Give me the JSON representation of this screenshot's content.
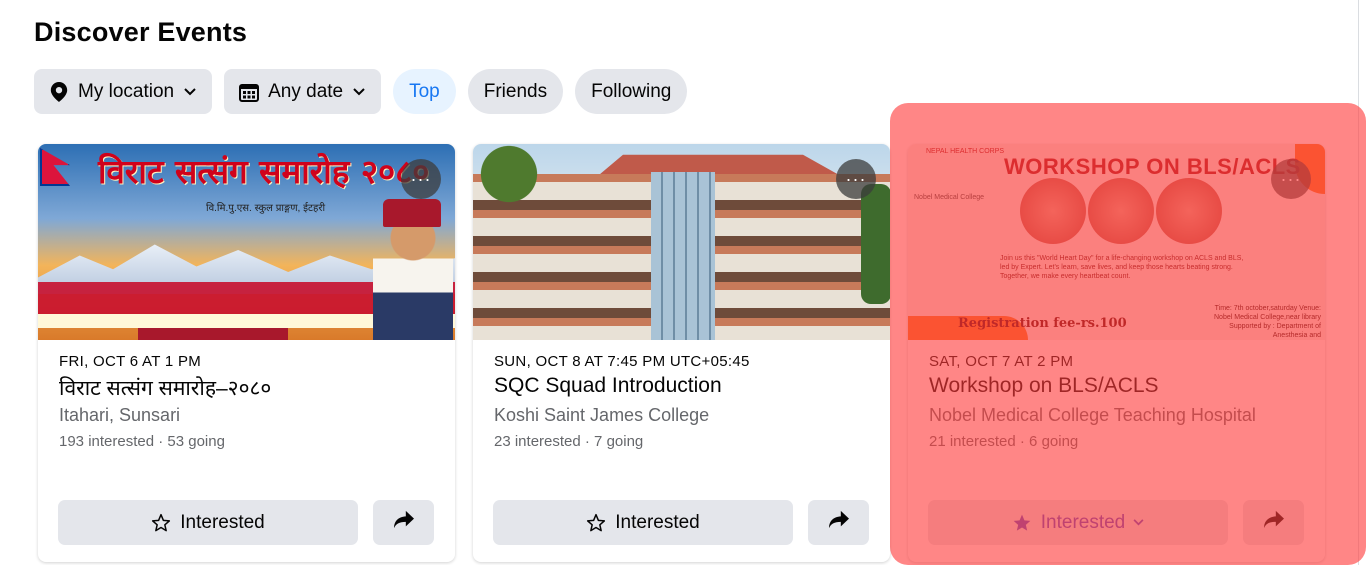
{
  "page": {
    "title": "Discover Events"
  },
  "filters": {
    "location_label": "My location",
    "date_label": "Any date",
    "tabs": [
      {
        "label": "Top",
        "active": true
      },
      {
        "label": "Friends",
        "active": false
      },
      {
        "label": "Following",
        "active": false
      }
    ]
  },
  "events": [
    {
      "date": "FRI, OCT 6 AT 1 PM",
      "title": "विराट सत्संग समारोह–२०८०",
      "place": "Itahari, Sunsari",
      "stats": "193 interested · 53 going",
      "interested_label": "Interested",
      "interested_state": false,
      "poster": {
        "headline": "विराट सत्संग समारोह २०८०",
        "subline": "वि.मि.पु.एस. स्कुल प्राङ्गण, ईटहरी"
      }
    },
    {
      "date": "SUN, OCT 8 AT 7:45 PM UTC+05:45",
      "title": "SQC Squad Introduction",
      "place": "Koshi Saint James College",
      "stats": "23 interested · 7 going",
      "interested_label": "Interested",
      "interested_state": false
    },
    {
      "date": "SAT, OCT 7 AT 2 PM",
      "title": "Workshop on BLS/ACLS",
      "place": "Nobel Medical College Teaching Hospital",
      "stats": "21 interested · 6 going",
      "interested_label": "Interested",
      "interested_state": true,
      "poster": {
        "headline": "WORKSHOP ON BLS/ACLS",
        "org": "Nobel Medical College",
        "logo_text": "NEPAL HEALTH CORPS",
        "body": "Join us this \"World Heart Day\" for a life-changing workshop on ACLS and BLS, led by Expert. Let's learn, save lives, and keep those hearts beating strong. Together, we make every heartbeat count.",
        "registration": "Registration fee-rs.100",
        "details": "Time: 7th october,saturday Venue: Nobel Medical College,near library Supported by : Department of Anesthesia and"
      }
    }
  ],
  "colors": {
    "accent": "#1877f2",
    "chip_bg": "#e4e6eb",
    "active_tab_bg": "#e7f3ff",
    "highlight_overlay": "#ff3c3c",
    "interested_star": "#5b4cc4"
  }
}
